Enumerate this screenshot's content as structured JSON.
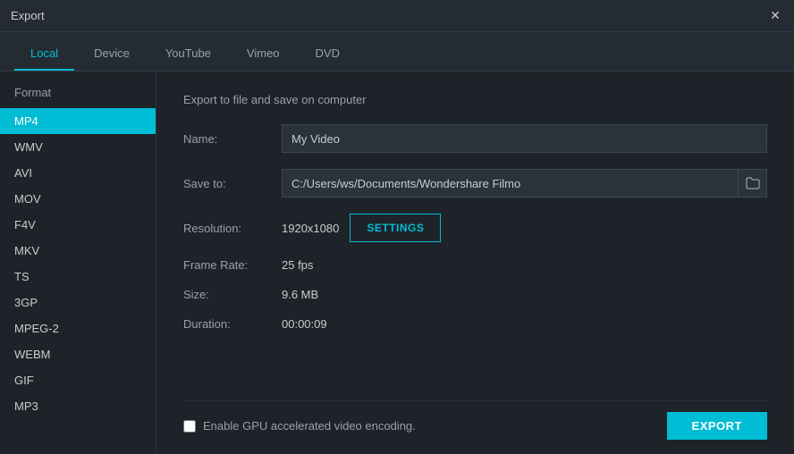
{
  "titleBar": {
    "title": "Export",
    "closeIcon": "✕"
  },
  "tabs": [
    {
      "id": "local",
      "label": "Local",
      "active": true
    },
    {
      "id": "device",
      "label": "Device",
      "active": false
    },
    {
      "id": "youtube",
      "label": "YouTube",
      "active": false
    },
    {
      "id": "vimeo",
      "label": "Vimeo",
      "active": false
    },
    {
      "id": "dvd",
      "label": "DVD",
      "active": false
    }
  ],
  "sidebar": {
    "header": "Format",
    "items": [
      {
        "label": "MP4",
        "active": true
      },
      {
        "label": "WMV",
        "active": false
      },
      {
        "label": "AVI",
        "active": false
      },
      {
        "label": "MOV",
        "active": false
      },
      {
        "label": "F4V",
        "active": false
      },
      {
        "label": "MKV",
        "active": false
      },
      {
        "label": "TS",
        "active": false
      },
      {
        "label": "3GP",
        "active": false
      },
      {
        "label": "MPEG-2",
        "active": false
      },
      {
        "label": "WEBM",
        "active": false
      },
      {
        "label": "GIF",
        "active": false
      },
      {
        "label": "MP3",
        "active": false
      }
    ]
  },
  "panel": {
    "title": "Export to file and save on computer",
    "fields": {
      "name": {
        "label": "Name:",
        "value": "My Video"
      },
      "saveTo": {
        "label": "Save to:",
        "value": "C:/Users/ws/Documents/Wondershare Filmo",
        "folderIcon": "📁"
      },
      "resolution": {
        "label": "Resolution:",
        "value": "1920x1080",
        "settingsLabel": "SETTINGS"
      },
      "frameRate": {
        "label": "Frame Rate:",
        "value": "25 fps"
      },
      "size": {
        "label": "Size:",
        "value": "9.6 MB"
      },
      "duration": {
        "label": "Duration:",
        "value": "00:00:09"
      }
    },
    "gpu": {
      "label": "Enable GPU accelerated video encoding."
    },
    "exportLabel": "EXPORT"
  }
}
